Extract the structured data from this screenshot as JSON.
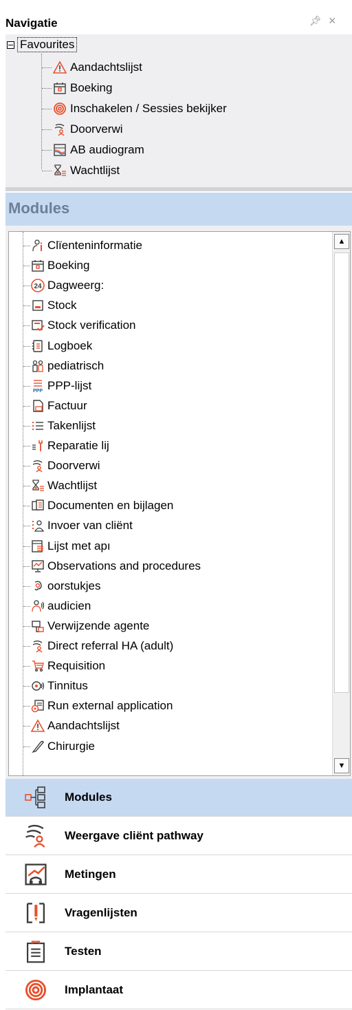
{
  "panel": {
    "title": "Navigatie",
    "pin_icon": "pin-icon",
    "close_icon": "close-icon"
  },
  "favourites": {
    "root_label": "Favourites",
    "items": [
      {
        "label": "Aandachtslijst",
        "icon": "warning-icon"
      },
      {
        "label": "Boeking",
        "icon": "calendar-icon"
      },
      {
        "label": "Inschakelen / Sessies bekijker",
        "icon": "spiral-icon"
      },
      {
        "label": "Doorverwi",
        "icon": "referral-icon"
      },
      {
        "label": "AB audiogram",
        "icon": "audiogram-icon"
      },
      {
        "label": "Wachtlijst",
        "icon": "waitlist-icon"
      }
    ]
  },
  "modules": {
    "header": "Modules",
    "items": [
      {
        "label": "Clïenteninformatie",
        "icon": "client-info-icon"
      },
      {
        "label": "Boeking",
        "icon": "calendar-icon"
      },
      {
        "label": "Dagweerg:",
        "icon": "24h-icon"
      },
      {
        "label": "Stock",
        "icon": "stock-icon"
      },
      {
        "label": "Stock verification",
        "icon": "stock-verify-icon"
      },
      {
        "label": "Logboek",
        "icon": "logbook-icon"
      },
      {
        "label": "pediatrisch",
        "icon": "pediatric-icon"
      },
      {
        "label": "PPP-lijst",
        "icon": "ppp-list-icon"
      },
      {
        "label": "Factuur",
        "icon": "invoice-icon"
      },
      {
        "label": "Takenlijst",
        "icon": "tasklist-icon"
      },
      {
        "label": "Reparatie lij",
        "icon": "repair-icon"
      },
      {
        "label": "Doorverwi",
        "icon": "referral-icon"
      },
      {
        "label": "Wachtlijst",
        "icon": "waitlist-icon"
      },
      {
        "label": "Documenten en bijlagen",
        "icon": "documents-icon"
      },
      {
        "label": "Invoer van cliënt",
        "icon": "client-input-icon"
      },
      {
        "label": "Lijst met apı",
        "icon": "appointment-list-icon"
      },
      {
        "label": "Observations and procedures",
        "icon": "observations-icon"
      },
      {
        "label": "oorstukjes",
        "icon": "earmold-icon"
      },
      {
        "label": "audicien",
        "icon": "audiologist-icon"
      },
      {
        "label": "Verwijzende agente",
        "icon": "referring-agent-icon"
      },
      {
        "label": "Direct referral HA (adult)",
        "icon": "direct-referral-icon"
      },
      {
        "label": "Requisition",
        "icon": "requisition-icon"
      },
      {
        "label": "Tinnitus",
        "icon": "tinnitus-icon"
      },
      {
        "label": "Run external application",
        "icon": "external-app-icon"
      },
      {
        "label": "Aandachtslijst",
        "icon": "warning-icon"
      },
      {
        "label": "Chirurgie",
        "icon": "surgery-icon"
      }
    ]
  },
  "nav_buttons": [
    {
      "label": "Modules",
      "icon": "modules-icon",
      "active": true
    },
    {
      "label": "Weergave cliënt pathway",
      "icon": "pathway-icon",
      "active": false
    },
    {
      "label": "Metingen",
      "icon": "measurements-icon",
      "active": false
    },
    {
      "label": "Vragenlijsten",
      "icon": "questionnaire-icon",
      "active": false
    },
    {
      "label": "Testen",
      "icon": "tests-icon",
      "active": false
    },
    {
      "label": "Implantaat",
      "icon": "implant-icon",
      "active": false
    }
  ],
  "colors": {
    "accent_orange": "#e8502d",
    "header_blue": "#c5d9f1",
    "header_text": "#6d7f97",
    "icon_dark": "#3c3c3c",
    "icon_blue": "#1f5fa8"
  }
}
